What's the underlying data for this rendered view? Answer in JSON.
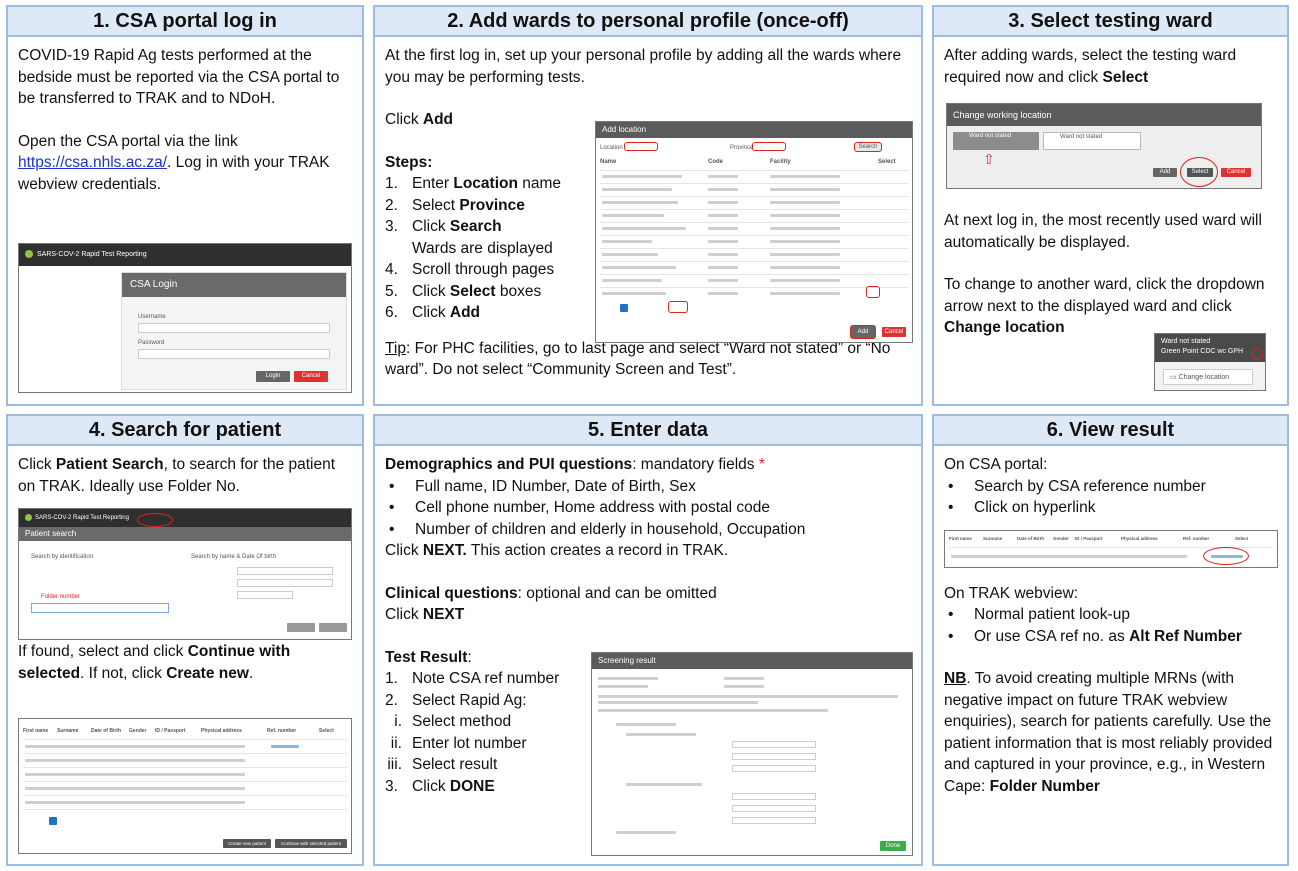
{
  "colors": {
    "panel_border": "#9dbde0",
    "panel_header": "#dde9f6",
    "link": "#1a34c8",
    "mark_red": "#d22222",
    "screenshot_header": "#5b5b5b"
  },
  "p1": {
    "title": "1. CSA portal log in",
    "para1": "COVID-19 Rapid Ag tests performed at the bedside must be reported via the CSA portal to be transferred to TRAK and to NDoH.",
    "para2_pre": "Open the CSA portal via the link ",
    "link": "https://csa.nhls.ac.za/",
    "para2_post": ". Log in with your TRAK webview credentials.",
    "shot": {
      "app": "SARS-COV-2 Rapid Test Reporting",
      "login_title": "CSA Login",
      "username": "Username",
      "password": "Password",
      "login_btn": "Login",
      "cancel_btn": "Cancel"
    }
  },
  "p2": {
    "title": "2. Add wards to personal profile (once-off)",
    "intro": "At the first log in, set up your personal profile by adding all the wards where you may be performing tests.",
    "click": "Click ",
    "click_b": "Add",
    "steps_label": "Steps:",
    "steps": [
      {
        "n": "1.",
        "pre": "Enter ",
        "b": "Location",
        "post": " name"
      },
      {
        "n": "2.",
        "pre": "Select ",
        "b": "Province",
        "post": ""
      },
      {
        "n": "3.",
        "pre": "Click ",
        "b": "Search",
        "post": ""
      },
      {
        "n": "",
        "pre": "Wards are displayed",
        "b": "",
        "post": ""
      },
      {
        "n": "4.",
        "pre": "Scroll through pages",
        "b": "",
        "post": ""
      },
      {
        "n": "5.",
        "pre": "Click ",
        "b": "Select",
        "post": " boxes"
      },
      {
        "n": "6.",
        "pre": "Click ",
        "b": "Add",
        "post": ""
      }
    ],
    "tip_label": "Tip",
    "tip": ": For PHC facilities, go to last page and select “Ward not stated” or “No ward”. Do not select “Community Screen and Test”.",
    "shot": {
      "title": "Add location",
      "location": "Location",
      "province": "Province",
      "search_btn": "Search",
      "cols": [
        "Name",
        "Code",
        "Facility",
        "Select"
      ],
      "add_btn": "Add",
      "cancel_btn": "Cancel"
    }
  },
  "p3": {
    "title": "3. Select testing ward",
    "para1_pre": "After adding wards, select the testing ward required now and click ",
    "para1_b": "Select",
    "para2": "At next log in, the most recently used ward will automatically be displayed.",
    "para3_pre": "To change to another ward, click the dropdown arrow next to the displayed ward and click ",
    "para3_b": "Change location",
    "shot": {
      "title": "Change working location",
      "ward1": "Ward not stated",
      "ward2": "Ward not stated",
      "add_btn": "Add",
      "select_btn": "Select",
      "cancel_btn": "Cancel"
    },
    "shot2": {
      "line1": "Ward not stated",
      "line2": "Green Point CDC wc GPH",
      "change_btn": "Change location"
    }
  },
  "p4": {
    "title": "4. Search for patient",
    "para1_pre": "Click ",
    "para1_b": "Patient Search",
    "para1_post": ", to search for the patient on TRAK. Ideally use Folder No.",
    "para2_pre": "If found, select and click ",
    "para2_b1": "Continue with selected",
    "para2_mid": ". If not, click ",
    "para2_b2": "Create new",
    "para2_post": ".",
    "shot": {
      "app": "SARS-COV-2 Rapid Test Reporting",
      "header": "Patient search",
      "by_id": "Search by identification",
      "by_name": "Search by name & Date Of birth",
      "folder_label": "Folder number"
    },
    "shot2": {
      "cols": [
        "First name",
        "Surname",
        "Date of Birth",
        "Gender",
        "ID / Passport",
        "Physical address",
        "Ref. number",
        "Select"
      ],
      "create_btn": "Create new patient",
      "continue_btn": "Continue with selected patient"
    }
  },
  "p5": {
    "title": "5. Enter data",
    "demo_b": "Demographics and PUI questions",
    "demo_post": ": mandatory fields ",
    "star": "*",
    "bullets": [
      "Full name, ID Number, Date of Birth, Sex",
      "Cell phone number, Home address with postal code",
      "Number of children and elderly in household, Occupation"
    ],
    "next1_pre": "Click ",
    "next1_b": "NEXT.",
    "next1_post": " This action creates a record in TRAK.",
    "clin_b": "Clinical questions",
    "clin_post": ": optional and can be omitted",
    "next2_pre": "Click ",
    "next2_b": "NEXT",
    "test_b": "Test Result",
    "test_post": ":",
    "steps": [
      {
        "n": "1.",
        "text": "Note CSA ref number"
      },
      {
        "n": "2.",
        "text": "Select Rapid Ag:"
      }
    ],
    "sub": [
      {
        "n": "i.",
        "text": "Select method"
      },
      {
        "n": "ii.",
        "text": "Enter lot number"
      },
      {
        "n": "iii.",
        "text": "Select result"
      }
    ],
    "step3_n": "3.",
    "step3_pre": "Click ",
    "step3_b": "DONE",
    "shot": {
      "title": "Screening result",
      "done_btn": "Done"
    }
  },
  "p6": {
    "title": "6. View result",
    "csa_label": "On CSA portal:",
    "csa_bullets": [
      "Search by CSA reference number",
      "Click on hyperlink"
    ],
    "trak_label": "On TRAK webview:",
    "trak_bullets": [
      {
        "pre": "Normal patient look-up",
        "b": ""
      },
      {
        "pre": "Or use CSA ref no. as ",
        "b": "Alt Ref Number"
      }
    ],
    "nb_label": "NB",
    "nb_text": ". To avoid creating multiple MRNs (with negative impact on future TRAK webview enquiries), search for patients carefully. Use the patient information that is most reliably provided and captured in your province, e.g., in Western Cape: ",
    "nb_b": "Folder Number"
  }
}
